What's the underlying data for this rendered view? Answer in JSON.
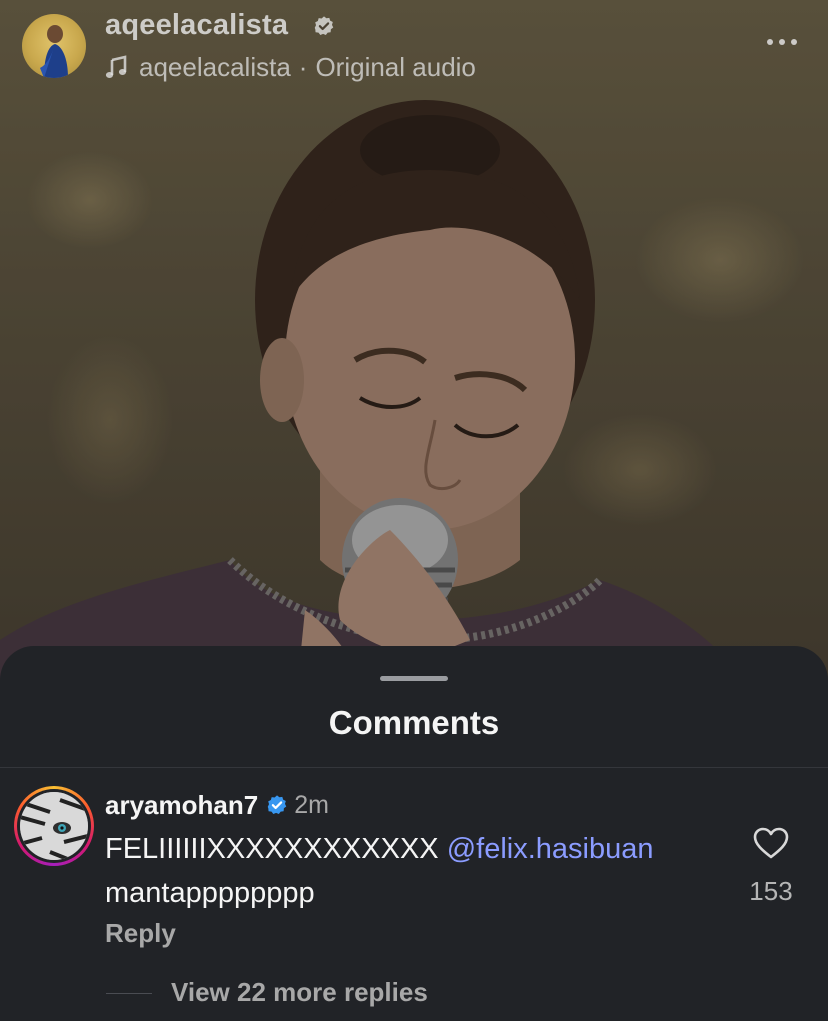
{
  "reel": {
    "username": "aqeelacalista",
    "audio_artist": "aqeelacalista",
    "audio_separator": "·",
    "audio_title": "Original audio",
    "icons": {
      "avatar": "profile-avatar",
      "verified": "verified-badge-icon",
      "music": "music-note-icon",
      "more": "more-options-icon"
    }
  },
  "comments_sheet": {
    "title": "Comments",
    "comments": [
      {
        "username": "aryamohan7",
        "time": "2m",
        "text": "FELIIIIIIXXXXXXXXXXXX",
        "mention": "@felix.hasibuan",
        "text_line2": "mantapppppppp",
        "reply_label": "Reply",
        "like_count": "153",
        "view_replies_label": "View 22 more replies"
      }
    ]
  },
  "colors": {
    "sheet_bg": "#212327",
    "mention": "#8b9cff",
    "verified": "#3897f0",
    "muted_text": "#a8a8a8"
  }
}
